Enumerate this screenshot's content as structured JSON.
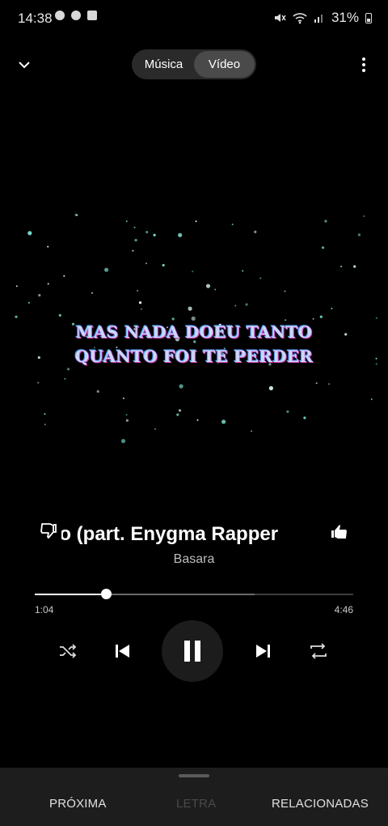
{
  "status_bar": {
    "time": "14:38",
    "battery": "31%",
    "icons_left": [
      "chrome-icon",
      "whatsapp-icon",
      "check-square-icon"
    ],
    "icons_right": [
      "mute-icon",
      "wifi-icon",
      "signal-icon",
      "battery-icon"
    ]
  },
  "header": {
    "toggle": {
      "options": [
        "Música",
        "Vídeo"
      ],
      "selected": "Vídeo"
    }
  },
  "video": {
    "lyrics": [
      "MAS NADA DOEU TANTO",
      "QUANTO FOI TE PERDER"
    ]
  },
  "track": {
    "title": "ro (part. Enygma Rapper",
    "artist": "Basara"
  },
  "progress": {
    "current": "1:04",
    "total": "4:46",
    "played_fraction": 0.224,
    "buffered_fraction": 0.69
  },
  "controls": [
    "shuffle-icon",
    "previous-icon",
    "pause-icon",
    "next-icon",
    "repeat-icon"
  ],
  "bottom_tabs": {
    "next": "PRÓXIMA",
    "lyrics": "LETRA",
    "related": "RELACIONADAS"
  },
  "colors": {
    "background": "#000000",
    "bottom_bar": "#1d1d1d",
    "disabled_tab": "#4a4a4a"
  }
}
